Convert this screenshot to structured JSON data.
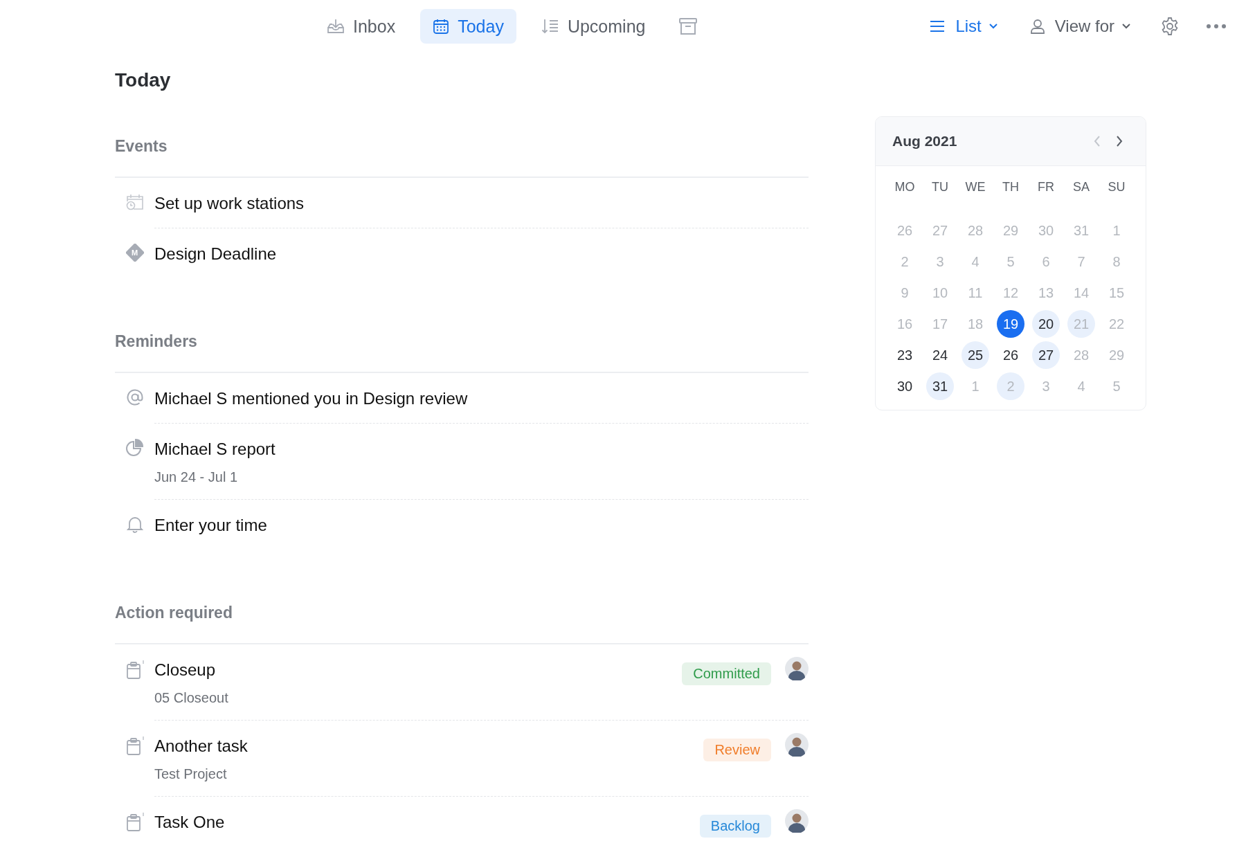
{
  "nav": {
    "tabs": [
      {
        "kind": "inbox",
        "label": "Inbox",
        "selected": false
      },
      {
        "kind": "today",
        "label": "Today",
        "selected": true
      },
      {
        "kind": "upcoming",
        "label": "Upcoming",
        "selected": false
      },
      {
        "kind": "archive",
        "selected": false
      }
    ],
    "tools": [
      {
        "kind": "list",
        "label": "List",
        "active": true
      },
      {
        "kind": "person",
        "label": "View for",
        "active": false
      }
    ]
  },
  "page": {
    "title": "Today"
  },
  "sections": [
    {
      "title": "Events",
      "items": [
        {
          "kind": "event",
          "title": "Set up work stations"
        },
        {
          "kind": "milestone",
          "icon_text": "M",
          "title": "Design Deadline"
        }
      ]
    },
    {
      "title": "Reminders",
      "items": [
        {
          "kind": "mention",
          "title": "Michael S mentioned you in Design review"
        },
        {
          "kind": "report",
          "title": "Michael S report",
          "subtitle": "Jun 24 - Jul 1"
        },
        {
          "kind": "reminder",
          "title": "Enter your time"
        }
      ]
    },
    {
      "title": "Action required",
      "items": [
        {
          "kind": "task",
          "title": "Closeup",
          "subtitle": "05 Closeout",
          "status": {
            "label": "Committed",
            "color": "#2e9b4a"
          }
        },
        {
          "kind": "task",
          "title": "Another task",
          "subtitle": "Test Project",
          "status": {
            "label": "Review",
            "color": "#f07d2a"
          }
        },
        {
          "kind": "task",
          "title": "Task One",
          "status": {
            "label": "Backlog",
            "color": "#2688d8"
          }
        }
      ]
    }
  ],
  "calendar": {
    "title": "Aug 2021",
    "prev_button": {
      "disabled": true
    },
    "next_button": {
      "disabled": false
    },
    "weekdays": [
      "MO",
      "TU",
      "WE",
      "TH",
      "FR",
      "SA",
      "SU"
    ],
    "weeks": [
      [
        {
          "day": "26",
          "dim": true,
          "marked": false,
          "selected": false
        },
        {
          "day": "27",
          "dim": true,
          "marked": false,
          "selected": false
        },
        {
          "day": "28",
          "dim": true,
          "marked": false,
          "selected": false
        },
        {
          "day": "29",
          "dim": true,
          "marked": false,
          "selected": false
        },
        {
          "day": "30",
          "dim": true,
          "marked": false,
          "selected": false
        },
        {
          "day": "31",
          "dim": true,
          "marked": false,
          "selected": false
        },
        {
          "day": "1",
          "dim": true,
          "marked": false,
          "selected": false
        }
      ],
      [
        {
          "day": "2",
          "dim": true,
          "marked": false,
          "selected": false
        },
        {
          "day": "3",
          "dim": true,
          "marked": false,
          "selected": false
        },
        {
          "day": "4",
          "dim": true,
          "marked": false,
          "selected": false
        },
        {
          "day": "5",
          "dim": true,
          "marked": false,
          "selected": false
        },
        {
          "day": "6",
          "dim": true,
          "marked": false,
          "selected": false
        },
        {
          "day": "7",
          "dim": true,
          "marked": false,
          "selected": false
        },
        {
          "day": "8",
          "dim": true,
          "marked": false,
          "selected": false
        }
      ],
      [
        {
          "day": "9",
          "dim": true,
          "marked": false,
          "selected": false
        },
        {
          "day": "10",
          "dim": true,
          "marked": false,
          "selected": false
        },
        {
          "day": "11",
          "dim": true,
          "marked": false,
          "selected": false
        },
        {
          "day": "12",
          "dim": true,
          "marked": false,
          "selected": false
        },
        {
          "day": "13",
          "dim": true,
          "marked": false,
          "selected": false
        },
        {
          "day": "14",
          "dim": true,
          "marked": false,
          "selected": false
        },
        {
          "day": "15",
          "dim": true,
          "marked": false,
          "selected": false
        }
      ],
      [
        {
          "day": "16",
          "dim": true,
          "marked": false,
          "selected": false
        },
        {
          "day": "17",
          "dim": true,
          "marked": false,
          "selected": false
        },
        {
          "day": "18",
          "dim": true,
          "marked": false,
          "selected": false
        },
        {
          "day": "19",
          "dim": false,
          "marked": false,
          "selected": true
        },
        {
          "day": "20",
          "dim": false,
          "marked": true,
          "selected": false
        },
        {
          "day": "21",
          "dim": true,
          "marked": true,
          "selected": false
        },
        {
          "day": "22",
          "dim": true,
          "marked": false,
          "selected": false
        }
      ],
      [
        {
          "day": "23",
          "dim": false,
          "marked": false,
          "selected": false
        },
        {
          "day": "24",
          "dim": false,
          "marked": false,
          "selected": false
        },
        {
          "day": "25",
          "dim": false,
          "marked": true,
          "selected": false
        },
        {
          "day": "26",
          "dim": false,
          "marked": false,
          "selected": false
        },
        {
          "day": "27",
          "dim": false,
          "marked": true,
          "selected": false
        },
        {
          "day": "28",
          "dim": true,
          "marked": false,
          "selected": false
        },
        {
          "day": "29",
          "dim": true,
          "marked": false,
          "selected": false
        }
      ],
      [
        {
          "day": "30",
          "dim": false,
          "marked": false,
          "selected": false
        },
        {
          "day": "31",
          "dim": false,
          "marked": true,
          "selected": false
        },
        {
          "day": "1",
          "dim": true,
          "marked": false,
          "selected": false
        },
        {
          "day": "2",
          "dim": true,
          "marked": true,
          "selected": false
        },
        {
          "day": "3",
          "dim": true,
          "marked": false,
          "selected": false
        },
        {
          "day": "4",
          "dim": true,
          "marked": false,
          "selected": false
        },
        {
          "day": "5",
          "dim": true,
          "marked": false,
          "selected": false
        }
      ]
    ]
  }
}
